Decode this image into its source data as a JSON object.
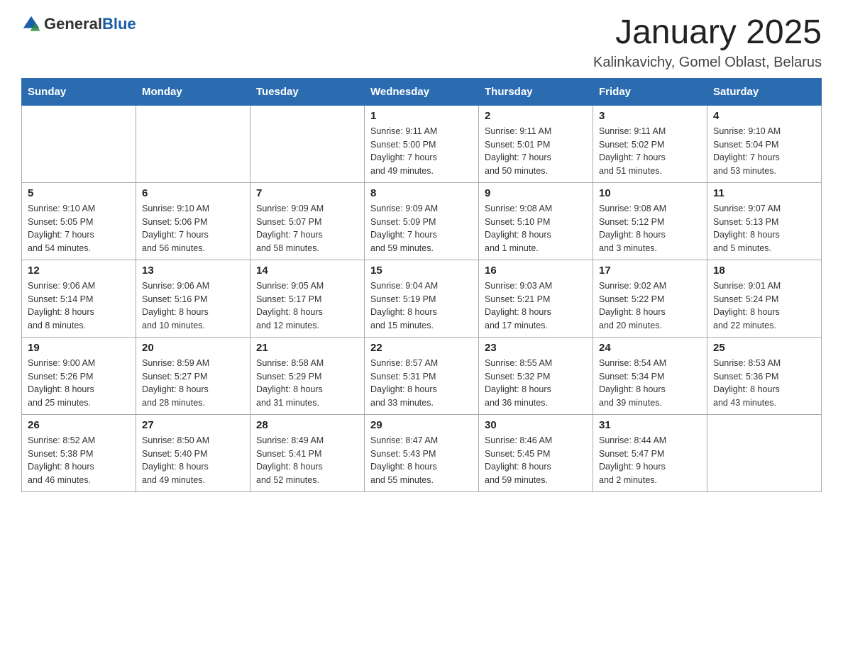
{
  "logo": {
    "general": "General",
    "blue": "Blue"
  },
  "header": {
    "title": "January 2025",
    "location": "Kalinkavichy, Gomel Oblast, Belarus"
  },
  "weekdays": [
    "Sunday",
    "Monday",
    "Tuesday",
    "Wednesday",
    "Thursday",
    "Friday",
    "Saturday"
  ],
  "weeks": [
    [
      {
        "day": "",
        "info": ""
      },
      {
        "day": "",
        "info": ""
      },
      {
        "day": "",
        "info": ""
      },
      {
        "day": "1",
        "info": "Sunrise: 9:11 AM\nSunset: 5:00 PM\nDaylight: 7 hours\nand 49 minutes."
      },
      {
        "day": "2",
        "info": "Sunrise: 9:11 AM\nSunset: 5:01 PM\nDaylight: 7 hours\nand 50 minutes."
      },
      {
        "day": "3",
        "info": "Sunrise: 9:11 AM\nSunset: 5:02 PM\nDaylight: 7 hours\nand 51 minutes."
      },
      {
        "day": "4",
        "info": "Sunrise: 9:10 AM\nSunset: 5:04 PM\nDaylight: 7 hours\nand 53 minutes."
      }
    ],
    [
      {
        "day": "5",
        "info": "Sunrise: 9:10 AM\nSunset: 5:05 PM\nDaylight: 7 hours\nand 54 minutes."
      },
      {
        "day": "6",
        "info": "Sunrise: 9:10 AM\nSunset: 5:06 PM\nDaylight: 7 hours\nand 56 minutes."
      },
      {
        "day": "7",
        "info": "Sunrise: 9:09 AM\nSunset: 5:07 PM\nDaylight: 7 hours\nand 58 minutes."
      },
      {
        "day": "8",
        "info": "Sunrise: 9:09 AM\nSunset: 5:09 PM\nDaylight: 7 hours\nand 59 minutes."
      },
      {
        "day": "9",
        "info": "Sunrise: 9:08 AM\nSunset: 5:10 PM\nDaylight: 8 hours\nand 1 minute."
      },
      {
        "day": "10",
        "info": "Sunrise: 9:08 AM\nSunset: 5:12 PM\nDaylight: 8 hours\nand 3 minutes."
      },
      {
        "day": "11",
        "info": "Sunrise: 9:07 AM\nSunset: 5:13 PM\nDaylight: 8 hours\nand 5 minutes."
      }
    ],
    [
      {
        "day": "12",
        "info": "Sunrise: 9:06 AM\nSunset: 5:14 PM\nDaylight: 8 hours\nand 8 minutes."
      },
      {
        "day": "13",
        "info": "Sunrise: 9:06 AM\nSunset: 5:16 PM\nDaylight: 8 hours\nand 10 minutes."
      },
      {
        "day": "14",
        "info": "Sunrise: 9:05 AM\nSunset: 5:17 PM\nDaylight: 8 hours\nand 12 minutes."
      },
      {
        "day": "15",
        "info": "Sunrise: 9:04 AM\nSunset: 5:19 PM\nDaylight: 8 hours\nand 15 minutes."
      },
      {
        "day": "16",
        "info": "Sunrise: 9:03 AM\nSunset: 5:21 PM\nDaylight: 8 hours\nand 17 minutes."
      },
      {
        "day": "17",
        "info": "Sunrise: 9:02 AM\nSunset: 5:22 PM\nDaylight: 8 hours\nand 20 minutes."
      },
      {
        "day": "18",
        "info": "Sunrise: 9:01 AM\nSunset: 5:24 PM\nDaylight: 8 hours\nand 22 minutes."
      }
    ],
    [
      {
        "day": "19",
        "info": "Sunrise: 9:00 AM\nSunset: 5:26 PM\nDaylight: 8 hours\nand 25 minutes."
      },
      {
        "day": "20",
        "info": "Sunrise: 8:59 AM\nSunset: 5:27 PM\nDaylight: 8 hours\nand 28 minutes."
      },
      {
        "day": "21",
        "info": "Sunrise: 8:58 AM\nSunset: 5:29 PM\nDaylight: 8 hours\nand 31 minutes."
      },
      {
        "day": "22",
        "info": "Sunrise: 8:57 AM\nSunset: 5:31 PM\nDaylight: 8 hours\nand 33 minutes."
      },
      {
        "day": "23",
        "info": "Sunrise: 8:55 AM\nSunset: 5:32 PM\nDaylight: 8 hours\nand 36 minutes."
      },
      {
        "day": "24",
        "info": "Sunrise: 8:54 AM\nSunset: 5:34 PM\nDaylight: 8 hours\nand 39 minutes."
      },
      {
        "day": "25",
        "info": "Sunrise: 8:53 AM\nSunset: 5:36 PM\nDaylight: 8 hours\nand 43 minutes."
      }
    ],
    [
      {
        "day": "26",
        "info": "Sunrise: 8:52 AM\nSunset: 5:38 PM\nDaylight: 8 hours\nand 46 minutes."
      },
      {
        "day": "27",
        "info": "Sunrise: 8:50 AM\nSunset: 5:40 PM\nDaylight: 8 hours\nand 49 minutes."
      },
      {
        "day": "28",
        "info": "Sunrise: 8:49 AM\nSunset: 5:41 PM\nDaylight: 8 hours\nand 52 minutes."
      },
      {
        "day": "29",
        "info": "Sunrise: 8:47 AM\nSunset: 5:43 PM\nDaylight: 8 hours\nand 55 minutes."
      },
      {
        "day": "30",
        "info": "Sunrise: 8:46 AM\nSunset: 5:45 PM\nDaylight: 8 hours\nand 59 minutes."
      },
      {
        "day": "31",
        "info": "Sunrise: 8:44 AM\nSunset: 5:47 PM\nDaylight: 9 hours\nand 2 minutes."
      },
      {
        "day": "",
        "info": ""
      }
    ]
  ]
}
